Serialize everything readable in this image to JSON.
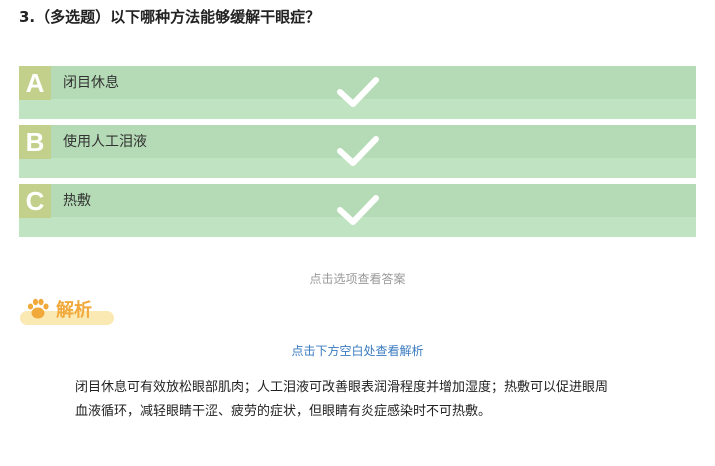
{
  "question": {
    "title": "3.（多选题）以下哪种方法能够缓解干眼症？"
  },
  "options": [
    {
      "letter": "A",
      "text": "闭目休息",
      "icon": "check-icon"
    },
    {
      "letter": "B",
      "text": "使用人工泪液",
      "icon": "check-icon"
    },
    {
      "letter": "C",
      "text": "热敷",
      "icon": "check-icon"
    }
  ],
  "reveal_hint": "点击选项查看答案",
  "analysis": {
    "label": "解析",
    "icon": "paw-icon",
    "hint": "点击下方空白处查看解析",
    "text": "闭目休息可有效放松眼部肌肉；人工泪液可改善眼表润滑程度并增加湿度；热敷可以促进眼周血液循环，减轻眼睛干涩、疲劳的症状，但眼睛有炎症感染时不可热敷。"
  },
  "colors": {
    "option_top": "#b4dbb5",
    "option_bottom": "#c0e3c1",
    "letter_badge": "#c3d08c",
    "analysis_label": "#f0a93a",
    "hint_link": "#3a7bc0"
  }
}
